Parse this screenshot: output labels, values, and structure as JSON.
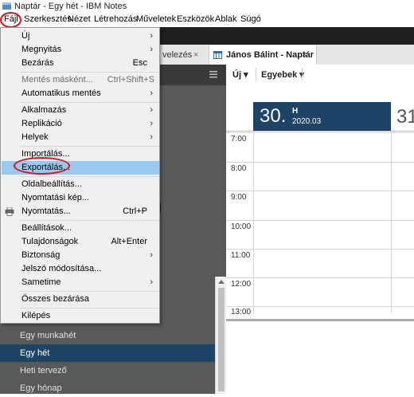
{
  "window": {
    "title": "Naptár - Egy hét - IBM Notes"
  },
  "menubar": {
    "items": [
      "Fájl",
      "Szerkesztés",
      "Nézet",
      "Létrehozás",
      "Műveletek",
      "Eszközök",
      "Ablak",
      "Súgó"
    ]
  },
  "tabs": {
    "mail": "velezés",
    "calendar": "János Bálint - Naptár",
    "close": "×"
  },
  "file_menu": {
    "items": [
      {
        "label": "Új",
        "shortcut": "",
        "arrow": "›"
      },
      {
        "label": "Megnyitás",
        "shortcut": "",
        "arrow": "›"
      },
      {
        "label": "Bezárás",
        "shortcut": "Esc",
        "arrow": ""
      },
      {
        "label": "Mentés másként...",
        "shortcut": "Ctrl+Shift+S",
        "arrow": ""
      },
      {
        "label": "Automatikus mentés",
        "shortcut": "",
        "arrow": "›"
      },
      {
        "label": "Alkalmazás",
        "shortcut": "",
        "arrow": "›"
      },
      {
        "label": "Replikáció",
        "shortcut": "",
        "arrow": "›"
      },
      {
        "label": "Helyek",
        "shortcut": "",
        "arrow": "›"
      },
      {
        "label": "Importálás...",
        "shortcut": "",
        "arrow": ""
      },
      {
        "label": "Exportálás...",
        "shortcut": "",
        "arrow": ""
      },
      {
        "label": "Oldalbeállítás...",
        "shortcut": "",
        "arrow": ""
      },
      {
        "label": "Nyomtatási kép...",
        "shortcut": "",
        "arrow": ""
      },
      {
        "label": "Nyomtatás...",
        "shortcut": "Ctrl+P",
        "arrow": ""
      },
      {
        "label": "Beállítások...",
        "shortcut": "",
        "arrow": ""
      },
      {
        "label": "Tulajdonságok",
        "shortcut": "Alt+Enter",
        "arrow": ""
      },
      {
        "label": "Biztonság",
        "shortcut": "",
        "arrow": "›"
      },
      {
        "label": "Jelszó módosítása...",
        "shortcut": "",
        "arrow": ""
      },
      {
        "label": "Sametime",
        "shortcut": "",
        "arrow": "›"
      },
      {
        "label": "Összes bezárása",
        "shortcut": "",
        "arrow": ""
      },
      {
        "label": "Kilépés",
        "shortcut": "",
        "arrow": ""
      }
    ]
  },
  "left_nav": {
    "items": [
      "Egy munkahét",
      "Egy hét",
      "Heti tervező",
      "Egy hónap"
    ],
    "selected": "Egy hét"
  },
  "calendar": {
    "toolbar": {
      "new_label": "Új ▾",
      "more_label": "Egyebek ▾"
    },
    "day": {
      "number": "30.",
      "weekday": "H",
      "month": "2020.03"
    },
    "next_day_partial": "31",
    "hours": [
      "7:00",
      "8:00",
      "9:00",
      "10:00",
      "11:00",
      "12:00",
      "13:00"
    ]
  },
  "colors": {
    "accent": "#1d4466",
    "highlight": "#99c9ef",
    "annotation": "#e0101a"
  }
}
